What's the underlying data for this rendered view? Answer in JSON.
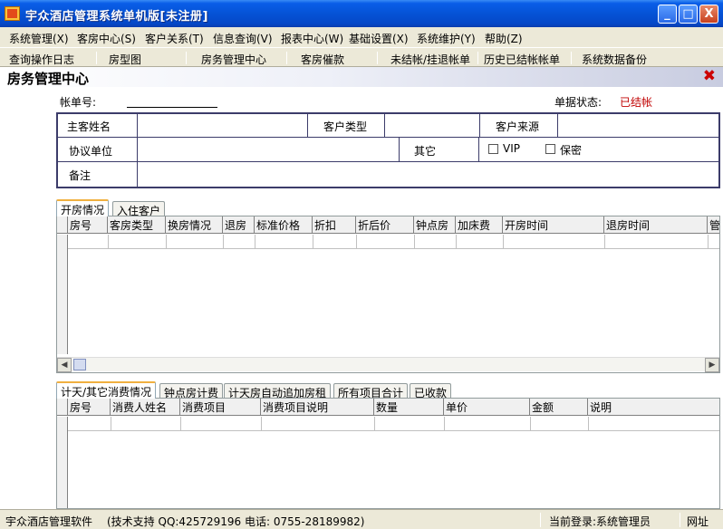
{
  "window": {
    "title": "宇众酒店管理系统单机版[未注册]",
    "min_label": "_",
    "max_label": "□",
    "close_label": "X"
  },
  "menu": [
    {
      "label": "系统管理(X)"
    },
    {
      "label": "客房中心(S)"
    },
    {
      "label": "客户关系(T)"
    },
    {
      "label": "信息查询(V)"
    },
    {
      "label": "报表中心(W)"
    },
    {
      "label": "基础设置(X)"
    },
    {
      "label": "系统维护(Y)"
    },
    {
      "label": "帮助(Z)"
    }
  ],
  "shortcuts": [
    {
      "label": "查询操作日志"
    },
    {
      "label": "房型图"
    },
    {
      "label": "房务管理中心"
    },
    {
      "label": "客房催款"
    },
    {
      "label": "未结帐/挂退帐单"
    },
    {
      "label": "历史已结帐帐单"
    },
    {
      "label": "系统数据备份"
    }
  ],
  "panel": {
    "title": "房务管理中心",
    "close_icon": "close-x-icon",
    "close_glyph": "✖",
    "bill_no_label": "帐单号:",
    "bill_status_label": "单据状态:",
    "bill_status_value": "已结帐",
    "status_color": "#c00000"
  },
  "form": {
    "guest_name_label": "主客姓名",
    "customer_type_label": "客户类型",
    "customer_source_label": "客户来源",
    "agreement_unit_label": "协议单位",
    "other_label": "其它",
    "vip_label": "VIP",
    "confidential_label": "保密",
    "remark_label": "备注"
  },
  "room_tabs": [
    {
      "label": "开房情况",
      "active": true
    },
    {
      "label": "入住客户",
      "active": false
    }
  ],
  "room_grid": {
    "columns": [
      "房号",
      "客房类型",
      "换房情况",
      "退房",
      "标准价格",
      "折扣",
      "折后价",
      "钟点房",
      "加床费",
      "开房时间",
      "退房时间",
      "管"
    ]
  },
  "consume_tabs": [
    {
      "label": "计天/其它消费情况",
      "active": true
    },
    {
      "label": "钟点房计费",
      "active": false
    },
    {
      "label": "计天房自动追加房租",
      "active": false
    },
    {
      "label": "所有项目合计",
      "active": false
    },
    {
      "label": "已收款",
      "active": false
    }
  ],
  "consume_grid": {
    "columns": [
      "房号",
      "消费人姓名",
      "消费项目",
      "消费项目说明",
      "数量",
      "单价",
      "金额",
      "说明"
    ]
  },
  "statusbar": {
    "app_name": "宇众酒店管理软件",
    "support": "(技术支持 QQ:425729196 电话: 0755-28189982)",
    "login": "当前登录:系统管理员",
    "network": "网址"
  }
}
